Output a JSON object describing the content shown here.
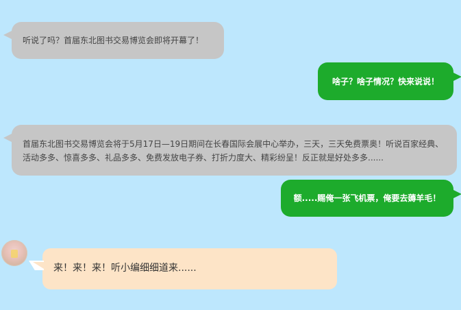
{
  "messages": [
    {
      "id": "msg1",
      "side": "left",
      "style": "gray",
      "text": "听说了吗？首届东北图书交易博览会即将开幕了！"
    },
    {
      "id": "msg2",
      "side": "right",
      "style": "green",
      "text": "啥子？啥子情况？快来说说！"
    },
    {
      "id": "msg3",
      "side": "left",
      "style": "gray",
      "text": "首届东北图书交易博览会将于5月17日—19日期间在长春国际会展中心举办，三天，三天免费票奥！听说百家经典、活动多多、惊喜多多、礼品多多、免费发放电子券、打折力度大、精彩纷呈！反正就是好处多多......"
    },
    {
      "id": "msg4",
      "side": "right",
      "style": "green",
      "text": "额.....赐俺一张飞机票，俺要去薅羊毛！"
    },
    {
      "id": "msg5",
      "side": "left",
      "style": "peach",
      "text": "来！来！来！听小编细细道来......"
    }
  ],
  "colors": {
    "background": "#bde7fd",
    "gray_bubble": "#c6c6c6",
    "green_bubble": "#1dab2c",
    "peach_bubble": "#fde4c7"
  },
  "icons": {
    "avatar": "user-avatar"
  }
}
